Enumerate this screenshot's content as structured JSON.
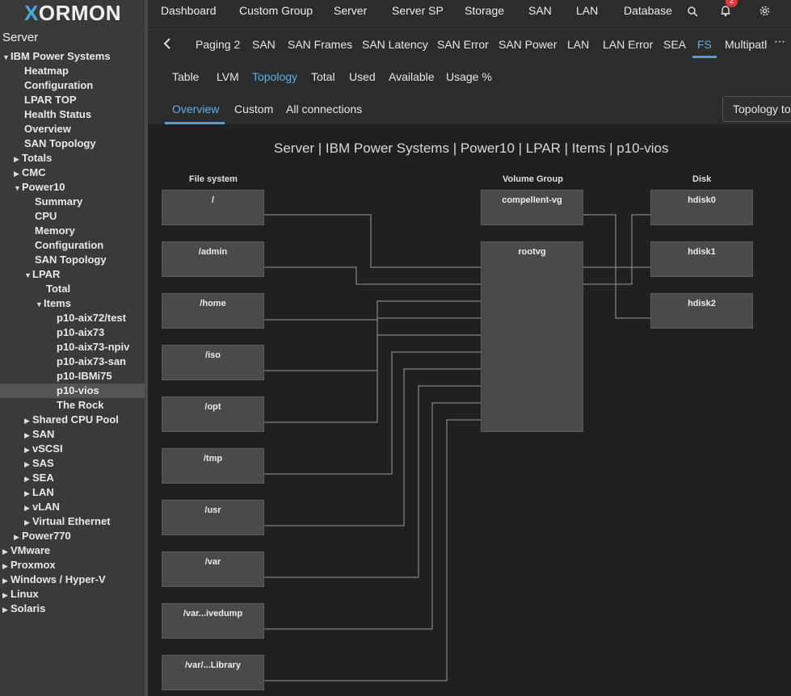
{
  "app": {
    "logo_x": "X",
    "logo_rest": "ORMON"
  },
  "sidebar": {
    "title": "Server",
    "tree": [
      {
        "label": "IBM Power Systems",
        "arrow": "▼"
      },
      {
        "label": "Heatmap",
        "arrow": ""
      },
      {
        "label": "Configuration",
        "arrow": ""
      },
      {
        "label": "LPAR TOP",
        "arrow": ""
      },
      {
        "label": "Health Status",
        "arrow": ""
      },
      {
        "label": "Overview",
        "arrow": ""
      },
      {
        "label": "SAN Topology",
        "arrow": ""
      },
      {
        "label": "Totals",
        "arrow": "▶"
      },
      {
        "label": "CMC",
        "arrow": "▶"
      },
      {
        "label": "Power10",
        "arrow": "▼"
      },
      {
        "label": "Summary",
        "arrow": ""
      },
      {
        "label": "CPU",
        "arrow": ""
      },
      {
        "label": "Memory",
        "arrow": ""
      },
      {
        "label": "Configuration",
        "arrow": ""
      },
      {
        "label": "SAN Topology",
        "arrow": ""
      },
      {
        "label": "LPAR",
        "arrow": "▼"
      },
      {
        "label": "Total",
        "arrow": ""
      },
      {
        "label": "Items",
        "arrow": "▼"
      },
      {
        "label": "p10-aix72/test",
        "arrow": ""
      },
      {
        "label": "p10-aix73",
        "arrow": ""
      },
      {
        "label": "p10-aix73-npiv",
        "arrow": ""
      },
      {
        "label": "p10-aix73-san",
        "arrow": ""
      },
      {
        "label": "p10-IBMi75",
        "arrow": ""
      },
      {
        "label": "p10-vios",
        "arrow": ""
      },
      {
        "label": "The Rock",
        "arrow": ""
      },
      {
        "label": "Shared CPU Pool",
        "arrow": "▶"
      },
      {
        "label": "SAN",
        "arrow": "▶"
      },
      {
        "label": "vSCSI",
        "arrow": "▶"
      },
      {
        "label": "SAS",
        "arrow": "▶"
      },
      {
        "label": "SEA",
        "arrow": "▶"
      },
      {
        "label": "LAN",
        "arrow": "▶"
      },
      {
        "label": "vLAN",
        "arrow": "▶"
      },
      {
        "label": "Virtual Ethernet",
        "arrow": "▶"
      },
      {
        "label": "Power770",
        "arrow": "▶"
      },
      {
        "label": "VMware",
        "arrow": "▶"
      },
      {
        "label": "Proxmox",
        "arrow": "▶"
      },
      {
        "label": "Windows / Hyper-V",
        "arrow": "▶"
      },
      {
        "label": "Linux",
        "arrow": "▶"
      },
      {
        "label": "Solaris",
        "arrow": "▶"
      }
    ]
  },
  "topnav": {
    "items": [
      "Dashboard",
      "Custom Group",
      "Server",
      "Server SP",
      "Storage",
      "SAN",
      "LAN",
      "Database"
    ],
    "active": "Server",
    "notification_count": "2",
    "icons": [
      "search-icon",
      "bell-icon",
      "gear-icon"
    ]
  },
  "subtabs": {
    "back_icon": "chevron-left-icon",
    "items": [
      "Paging 2",
      "SAN",
      "SAN Frames",
      "SAN Latency",
      "SAN Error",
      "SAN Power",
      "LAN",
      "LAN Error",
      "SEA",
      "FS",
      "Multipath"
    ],
    "active": "FS",
    "more_icon": "more-icon"
  },
  "viewtabs": {
    "items": [
      "Table",
      "LVM",
      "Topology",
      "Total",
      "Used",
      "Available",
      "Usage %"
    ],
    "active": "Topology"
  },
  "topotabs": {
    "items": [
      "Overview",
      "Custom",
      "All connections"
    ],
    "active": "Overview",
    "button": "Topology to"
  },
  "diagram": {
    "title": "Server | IBM Power Systems | Power10 | LPAR | Items | p10-vios",
    "columns": {
      "fs": "File system",
      "vg": "Volume Group",
      "disk": "Disk"
    },
    "filesystems": [
      "/",
      "/admin",
      "/home",
      "/iso",
      "/opt",
      "/tmp",
      "/usr",
      "/var",
      "/var...ivedump",
      "/var/...Library"
    ],
    "volume_groups": [
      "compellent-vg",
      "rootvg"
    ],
    "disks": [
      "hdisk0",
      "hdisk1",
      "hdisk2"
    ]
  }
}
